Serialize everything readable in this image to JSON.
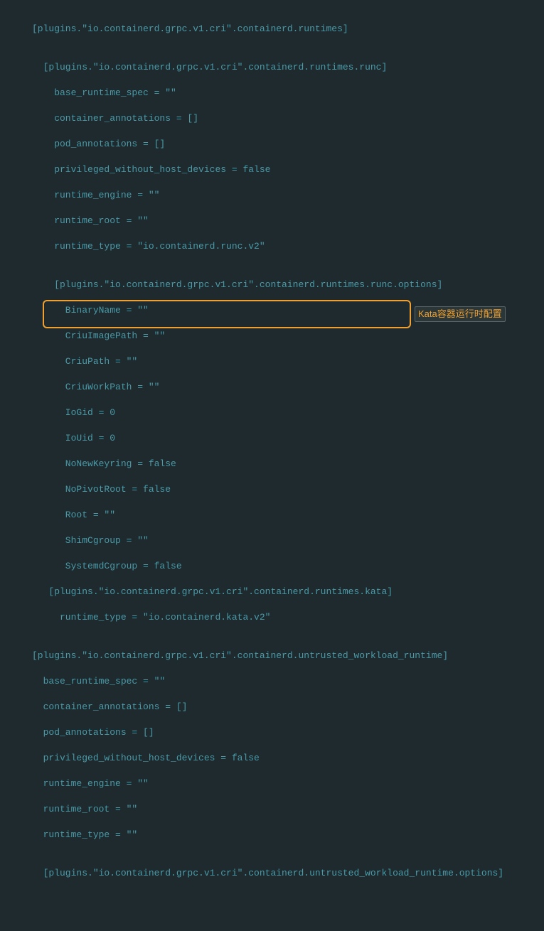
{
  "code": {
    "lines": [
      "[plugins.\"io.containerd.grpc.v1.cri\".containerd.runtimes]",
      "",
      "  [plugins.\"io.containerd.grpc.v1.cri\".containerd.runtimes.runc]",
      "    base_runtime_spec = \"\"",
      "    container_annotations = []",
      "    pod_annotations = []",
      "    privileged_without_host_devices = false",
      "    runtime_engine = \"\"",
      "    runtime_root = \"\"",
      "    runtime_type = \"io.containerd.runc.v2\"",
      "",
      "    [plugins.\"io.containerd.grpc.v1.cri\".containerd.runtimes.runc.options]",
      "      BinaryName = \"\"",
      "      CriuImagePath = \"\"",
      "      CriuPath = \"\"",
      "      CriuWorkPath = \"\"",
      "      IoGid = 0",
      "      IoUid = 0",
      "      NoNewKeyring = false",
      "      NoPivotRoot = false",
      "      Root = \"\"",
      "      ShimCgroup = \"\"",
      "      SystemdCgroup = false",
      "   [plugins.\"io.containerd.grpc.v1.cri\".containerd.runtimes.kata]",
      "     runtime_type = \"io.containerd.kata.v2\"",
      "",
      "[plugins.\"io.containerd.grpc.v1.cri\".containerd.untrusted_workload_runtime]",
      "  base_runtime_spec = \"\"",
      "  container_annotations = []",
      "  pod_annotations = []",
      "  privileged_without_host_devices = false",
      "  runtime_engine = \"\"",
      "  runtime_root = \"\"",
      "  runtime_type = \"\"",
      "",
      "  [plugins.\"io.containerd.grpc.v1.cri\".containerd.untrusted_workload_runtime.options]"
    ]
  },
  "annotation": {
    "label": "Kata容器运行时配置"
  },
  "colors": {
    "background": "#1e2a2e",
    "text": "#4a9aa8",
    "highlight_border": "#f0a030",
    "annotation_text": "#f0a030"
  }
}
